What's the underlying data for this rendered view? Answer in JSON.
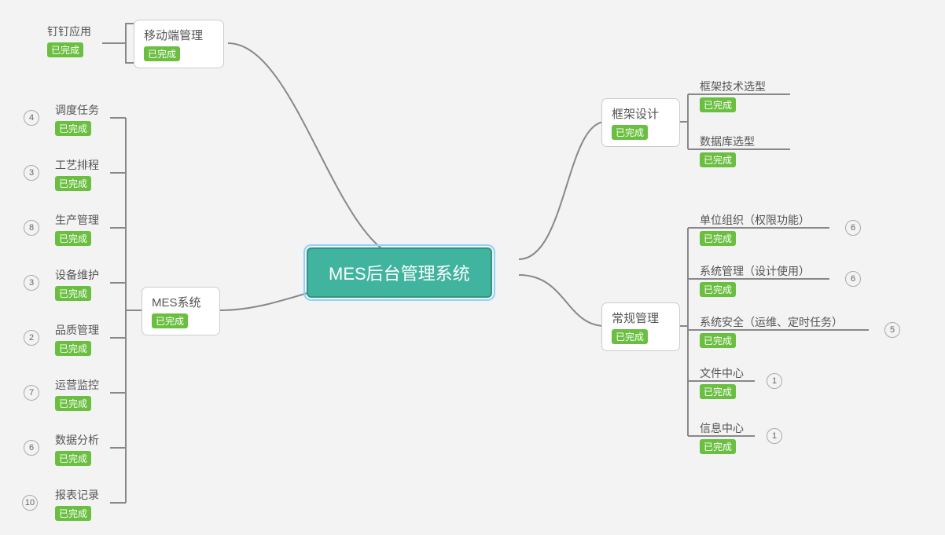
{
  "root": {
    "title": "MES后台管理系统"
  },
  "status_label": "已完成",
  "branches": {
    "mobile": {
      "title": "移动端管理",
      "children": [
        {
          "title": "钉钉应用"
        }
      ]
    },
    "mes": {
      "title": "MES系统",
      "children": [
        {
          "title": "调度任务",
          "count": 4
        },
        {
          "title": "工艺排程",
          "count": 3
        },
        {
          "title": "生产管理",
          "count": 8
        },
        {
          "title": "设备维护",
          "count": 3
        },
        {
          "title": "品质管理",
          "count": 2
        },
        {
          "title": "运营监控",
          "count": 7
        },
        {
          "title": "数据分析",
          "count": 6
        },
        {
          "title": "报表记录",
          "count": 10
        }
      ]
    },
    "frame": {
      "title": "框架设计",
      "children": [
        {
          "title": "框架技术选型"
        },
        {
          "title": "数据库选型"
        }
      ]
    },
    "routine": {
      "title": "常规管理",
      "children": [
        {
          "title": "单位组织（权限功能）",
          "count": 6
        },
        {
          "title": "系统管理（设计使用）",
          "count": 6
        },
        {
          "title": "系统安全（运维、定时任务）",
          "count": 5
        },
        {
          "title": "文件中心",
          "count": 1
        },
        {
          "title": "信息中心",
          "count": 1
        }
      ]
    }
  }
}
